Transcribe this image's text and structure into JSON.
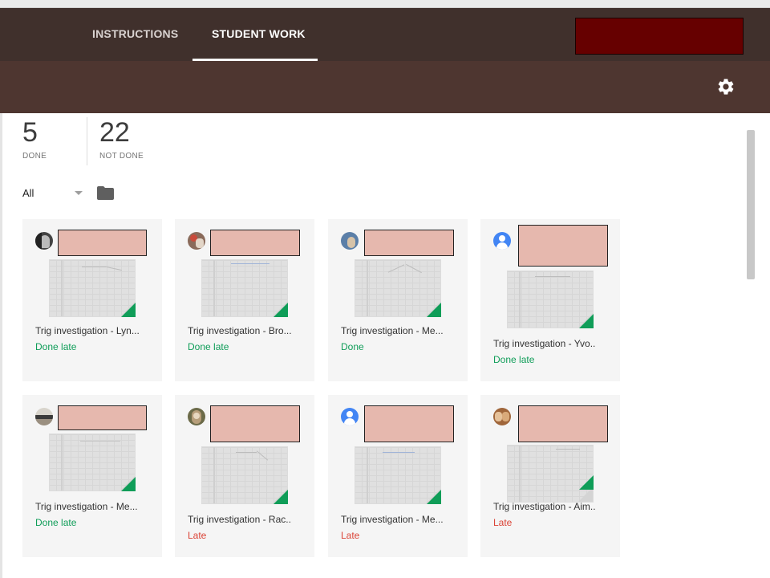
{
  "header": {
    "tabs": [
      {
        "label": "INSTRUCTIONS",
        "active": false
      },
      {
        "label": "STUDENT WORK",
        "active": true
      }
    ]
  },
  "stats": {
    "done": {
      "count": "5",
      "label": "DONE"
    },
    "not_done": {
      "count": "22",
      "label": "NOT DONE"
    }
  },
  "filter": {
    "selected": "All"
  },
  "colors": {
    "header_bg": "#40302c",
    "subheader_bg": "#4e3630",
    "done": "#0f9d58",
    "late": "#db4437",
    "sheets_green": "#0f9d58"
  },
  "icons": {
    "settings": "gear-icon",
    "folder": "folder-icon",
    "dropdown": "caret-down-icon",
    "file": "google-sheets-icon"
  },
  "cards": [
    {
      "title": "Trig investigation - Lyn...",
      "status": "Done late",
      "status_type": "done"
    },
    {
      "title": "Trig investigation - Bro...",
      "status": "Done late",
      "status_type": "done"
    },
    {
      "title": "Trig investigation - Me...",
      "status": "Done",
      "status_type": "done"
    },
    {
      "title": "Trig investigation - Yvo..",
      "status": "Done late",
      "status_type": "done"
    },
    {
      "title": "Trig investigation - Me...",
      "status": "Done late",
      "status_type": "done"
    },
    {
      "title": "Trig investigation - Rac..",
      "status": "Late",
      "status_type": "late"
    },
    {
      "title": "Trig investigation - Me...",
      "status": "Late",
      "status_type": "late"
    },
    {
      "title": "Trig investigation - Aim..",
      "status": "Late",
      "status_type": "late"
    }
  ]
}
